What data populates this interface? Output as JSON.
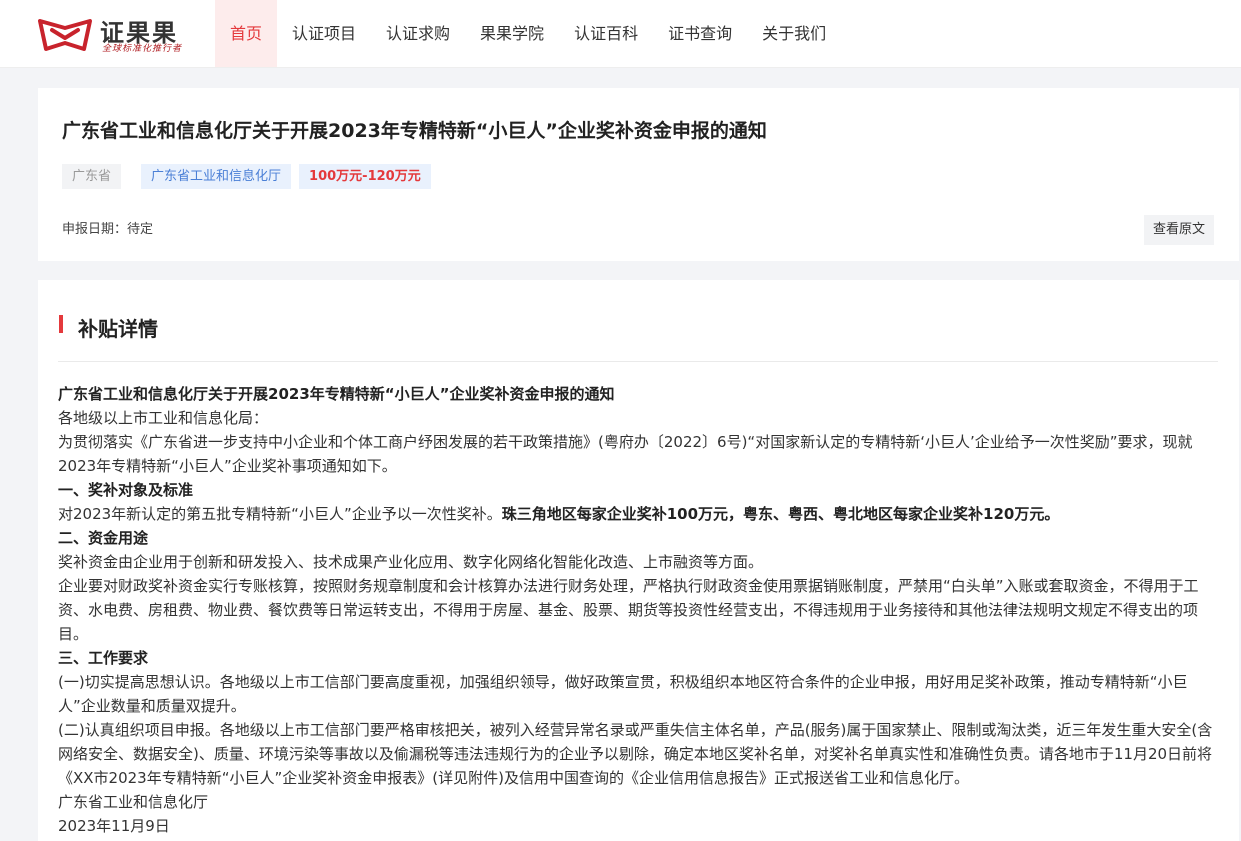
{
  "header": {
    "logo": {
      "name": "证果果",
      "slogan": "全球标准化推行者",
      "brand_color": "#c8232c"
    },
    "nav": [
      {
        "label": "首页",
        "active": true
      },
      {
        "label": "认证项目"
      },
      {
        "label": "认证求购"
      },
      {
        "label": "果果学院"
      },
      {
        "label": "认证百科"
      },
      {
        "label": "证书查询"
      },
      {
        "label": "关于我们"
      }
    ]
  },
  "notice": {
    "title": "广东省工业和信息化厅关于开展2023年专精特新“小巨人”企业奖补资金申报的通知",
    "tags": {
      "region": "广东省",
      "department": "广东省工业和信息化厅",
      "amount": "100万元-120万元"
    },
    "apply_date": "申报日期：待定",
    "view_original_label": "查看原文"
  },
  "detail": {
    "section_title": "补贴详情",
    "heading": "广东省工业和信息化厅关于开展2023年专精特新“小巨人”企业奖补资金申报的通知",
    "salutation": "各地级以上市工业和信息化局：",
    "intro": "为贯彻落实《广东省进一步支持中小企业和个体工商户纾困发展的若干政策措施》(粤府办〔2022〕6号)“对国家新认定的专精特新‘小巨人’企业给予一次性奖励”要求，现就2023年专精特新“小巨人”企业奖补事项通知如下。",
    "s1_title": "一、奖补对象及标准",
    "s1_text": "对2023年新认定的第五批专精特新“小巨人”企业予以一次性奖补。",
    "s1_bold": "珠三角地区每家企业奖补100万元，粤东、粤西、粤北地区每家企业奖补120万元。",
    "s2_title": "二、资金用途",
    "s2_p1": "奖补资金由企业用于创新和研发投入、技术成果产业化应用、数字化网络化智能化改造、上市融资等方面。",
    "s2_p2": "企业要对财政奖补资金实行专账核算，按照财务规章制度和会计核算办法进行财务处理，严格执行财政资金使用票据销账制度，严禁用“白头单”入账或套取资金，不得用于工资、水电费、房租费、物业费、餐饮费等日常运转支出，不得用于房屋、基金、股票、期货等投资性经营支出，不得违规用于业务接待和其他法律法规明文规定不得支出的项目。",
    "s3_title": "三、工作要求",
    "s3_p1": "(一)切实提高思想认识。各地级以上市工信部门要高度重视，加强组织领导，做好政策宣贯，积极组织本地区符合条件的企业申报，用好用足奖补政策，推动专精特新“小巨人”企业数量和质量双提升。",
    "s3_p2": "(二)认真组织项目申报。各地级以上市工信部门要严格审核把关，被列入经营异常名录或严重失信主体名单，产品(服务)属于国家禁止、限制或淘汰类，近三年发生重大安全(含网络安全、数据安全)、质量、环境污染等事故以及偷漏税等违法违规行为的企业予以剔除，确定本地区奖补名单，对奖补名单真实性和准确性负责。请各地市于11月20日前将《XX市2023年专精特新“小巨人”企业奖补资金申报表》(详见附件)及信用中国查询的《企业信用信息报告》正式报送省工业和信息化厅。",
    "signature": "广东省工业和信息化厅",
    "date": "2023年11月9日"
  }
}
